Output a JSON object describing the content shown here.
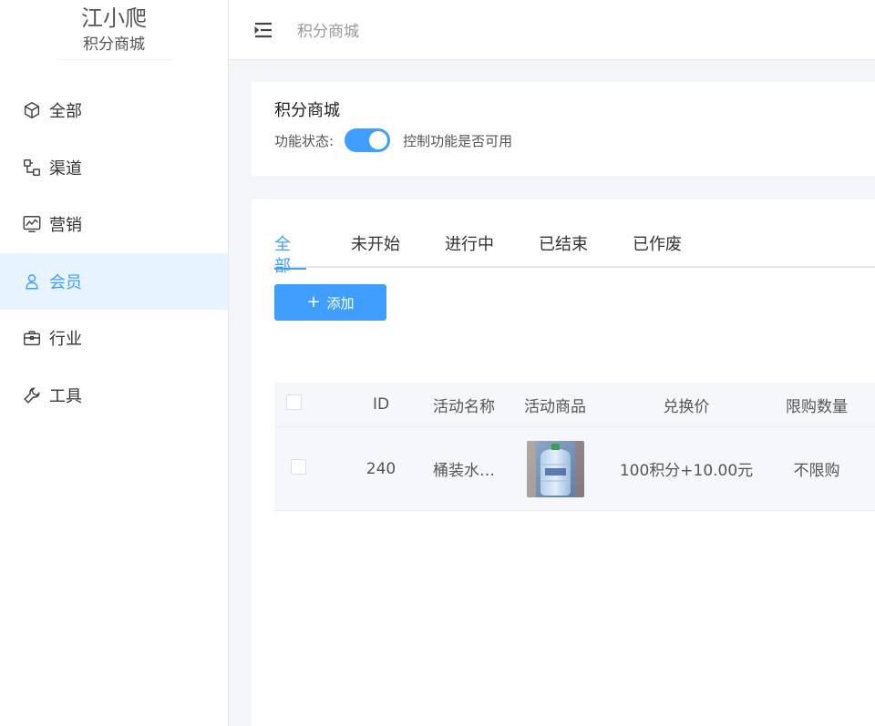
{
  "brand": {
    "title": "江小爬",
    "subtitle": "积分商城"
  },
  "sidebar": {
    "items": [
      {
        "label": "全部",
        "icon": "cube-icon",
        "active": false
      },
      {
        "label": "渠道",
        "icon": "channel-icon",
        "active": false
      },
      {
        "label": "营销",
        "icon": "chart-icon",
        "active": false
      },
      {
        "label": "会员",
        "icon": "user-icon",
        "active": true
      },
      {
        "label": "行业",
        "icon": "briefcase-icon",
        "active": false
      },
      {
        "label": "工具",
        "icon": "wrench-icon",
        "active": false
      }
    ]
  },
  "header": {
    "breadcrumb": "积分商城"
  },
  "settings": {
    "title": "积分商城",
    "status_label": "功能状态:",
    "switch_on": true,
    "status_desc": "控制功能是否可用"
  },
  "tabs": [
    {
      "label": "全部",
      "active": true
    },
    {
      "label": "未开始",
      "active": false
    },
    {
      "label": "进行中",
      "active": false
    },
    {
      "label": "已结束",
      "active": false
    },
    {
      "label": "已作废",
      "active": false
    }
  ],
  "actions": {
    "add_label": "添加"
  },
  "table": {
    "columns": [
      "ID",
      "活动名称",
      "活动商品",
      "兑换价",
      "限购数量"
    ],
    "rows": [
      {
        "id": "240",
        "name": "桶装水…",
        "price": "100积分+10.00元",
        "limit": "不限购"
      }
    ]
  },
  "colors": {
    "accent": "#409eff",
    "active_bg": "#e7f3fe"
  }
}
